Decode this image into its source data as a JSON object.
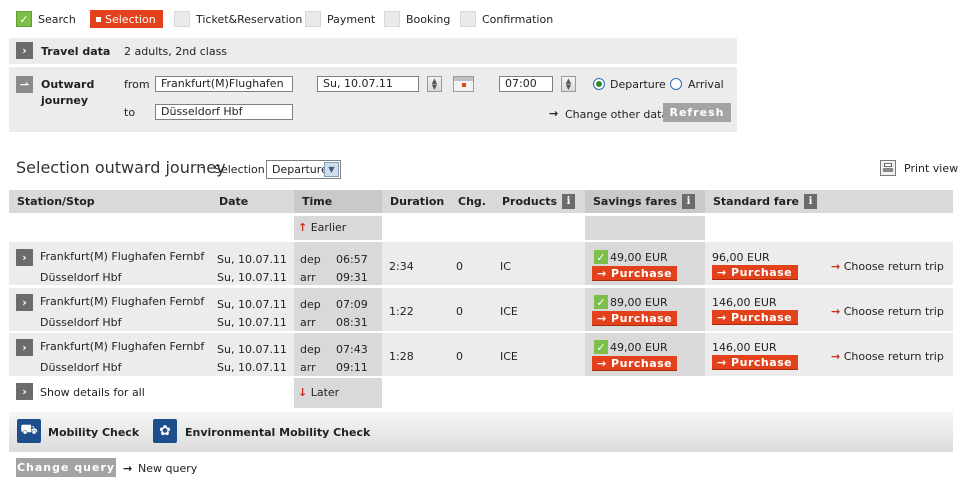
{
  "steps": [
    {
      "label": "Search",
      "done": true
    },
    {
      "label": "Selection",
      "active": true
    },
    {
      "label": "Ticket&Reservation"
    },
    {
      "label": "Payment"
    },
    {
      "label": "Booking"
    },
    {
      "label": "Confirmation"
    }
  ],
  "travel_data": {
    "label": "Travel data",
    "value": "2 adults, 2nd class"
  },
  "outward": {
    "label_line1": "Outward",
    "label_line2": "journey",
    "from_label": "from",
    "from_value": "Frankfurt(M)Flughafen",
    "to_label": "to",
    "to_value": "Düsseldorf Hbf",
    "date_value": "Su, 10.07.11",
    "time_value": "07:00",
    "departure_label": "Departure",
    "arrival_label": "Arrival",
    "change_other": "Change other data",
    "refresh": "Refresh"
  },
  "selection": {
    "title": "Selection outward journey",
    "dash": "-",
    "select_label": "Selection",
    "select_value": "Departure",
    "print_view": "Print view"
  },
  "table": {
    "headers": {
      "station": "Station/Stop",
      "date": "Date",
      "time": "Time",
      "duration": "Duration",
      "chg": "Chg.",
      "products": "Products",
      "savings": "Savings fares",
      "standard": "Standard fare"
    },
    "earlier": "Earlier",
    "later": "Later",
    "show_details": "Show details for all",
    "purchase_label": "Purchase",
    "choose_return": "Choose return trip",
    "rows": [
      {
        "from": "Frankfurt(M) Flughafen Fernbf",
        "to": "Düsseldorf Hbf",
        "date1": "Su, 10.07.11",
        "date2": "Su, 10.07.11",
        "dep_label": "dep",
        "dep": "06:57",
        "arr_label": "arr",
        "arr": "09:31",
        "duration": "2:34",
        "chg": "0",
        "product": "IC",
        "savings": "49,00 EUR",
        "standard": "96,00 EUR"
      },
      {
        "from": "Frankfurt(M) Flughafen Fernbf",
        "to": "Düsseldorf Hbf",
        "date1": "Su, 10.07.11",
        "date2": "Su, 10.07.11",
        "dep_label": "dep",
        "dep": "07:09",
        "arr_label": "arr",
        "arr": "08:31",
        "duration": "1:22",
        "chg": "0",
        "product": "ICE",
        "savings": "89,00 EUR",
        "standard": "146,00 EUR"
      },
      {
        "from": "Frankfurt(M) Flughafen Fernbf",
        "to": "Düsseldorf Hbf",
        "date1": "Su, 10.07.11",
        "date2": "Su, 10.07.11",
        "dep_label": "dep",
        "dep": "07:43",
        "arr_label": "arr",
        "arr": "09:11",
        "duration": "1:28",
        "chg": "0",
        "product": "ICE",
        "savings": "49,00 EUR",
        "standard": "146,00 EUR"
      }
    ]
  },
  "footer": {
    "mobility_check": "Mobility Check",
    "env_check": "Environmental Mobility Check",
    "change_query": "Change query",
    "new_query": "New query"
  },
  "colors": {
    "accent": "#e2411b",
    "panel": "#ececec",
    "header": "#d9d9d9",
    "check": "#7cbf4a"
  }
}
